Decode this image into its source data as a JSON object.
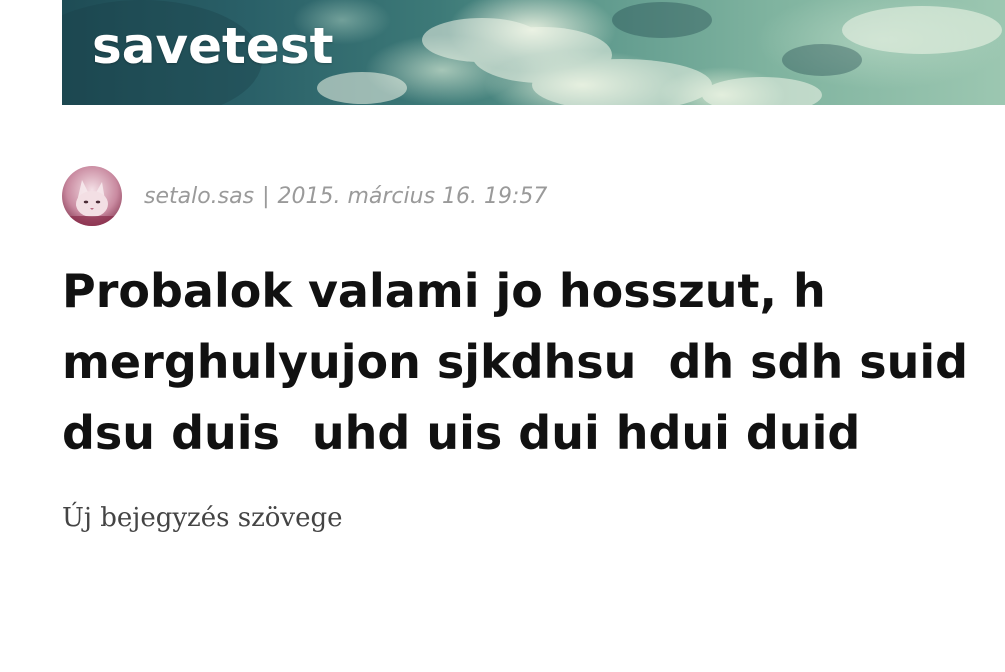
{
  "header": {
    "site_title": "savetest"
  },
  "post": {
    "author": "setalo.sas",
    "separator": "|",
    "date": "2015. március 16. 19:57",
    "title": "Probalok valami jo hosszut, h merghulyujon sjkdhsu  dh sdh suid  dsu duis  uhd uis dui hdui duid",
    "body": "Új bejegyzés szövege"
  },
  "colors": {
    "title_text": "#111111",
    "meta_text": "#9a9a9a",
    "body_text": "#444444",
    "header_banner": "#2a6068"
  }
}
